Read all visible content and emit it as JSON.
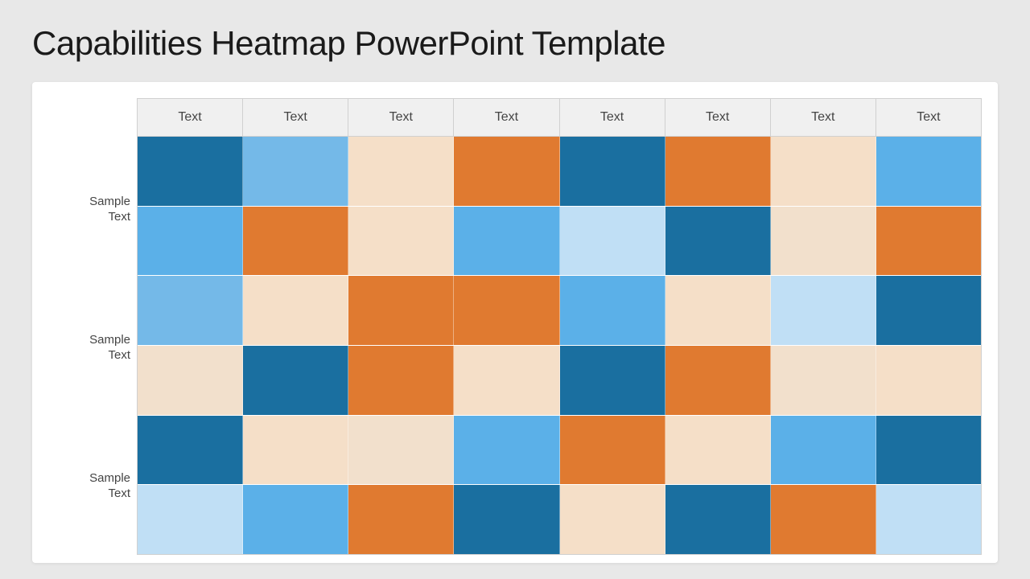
{
  "title": "Capabilities Heatmap PowerPoint Template",
  "header": {
    "columns": [
      "Text",
      "Text",
      "Text",
      "Text",
      "Text",
      "Text",
      "Text",
      "Text"
    ]
  },
  "rows": [
    {
      "label": "Sample\nText",
      "subrows": [
        [
          "dark-blue",
          "light-blue",
          "pale-peach",
          "orange",
          "dark-blue",
          "orange",
          "pale-peach",
          "sky-blue"
        ],
        [
          "sky-blue",
          "orange",
          "pale-peach",
          "sky-blue",
          "v-light-blue",
          "dark-blue",
          "peach-light",
          "orange"
        ]
      ]
    },
    {
      "label": "Sample\nText",
      "subrows": [
        [
          "light-blue",
          "pale-peach",
          "orange",
          "orange",
          "sky-blue",
          "pale-peach",
          "v-light-blue",
          "dark-blue"
        ],
        [
          "peach-light",
          "dark-blue",
          "orange",
          "pale-peach",
          "dark-blue",
          "orange",
          "peach-light",
          "pale-peach"
        ]
      ]
    },
    {
      "label": "Sample\nText",
      "subrows": [
        [
          "dark-blue",
          "pale-peach",
          "orange",
          "sky-blue",
          "orange",
          "pale-peach",
          "sky-blue",
          "dark-blue"
        ],
        [
          "v-light-blue",
          "sky-blue",
          "orange",
          "dark-blue",
          "pale-peach",
          "dark-blue",
          "orange",
          "v-light-blue"
        ]
      ]
    }
  ],
  "colors": {
    "dark-blue": "#1a6fa0",
    "light-blue": "#74b9e8",
    "pale-peach": "#f5dfc8",
    "orange": "#e07a30",
    "sky-blue": "#5bb0e8",
    "mid-blue": "#1e7db8",
    "peach-light": "#f2e0cc",
    "v-light-blue": "#c0dff5"
  }
}
